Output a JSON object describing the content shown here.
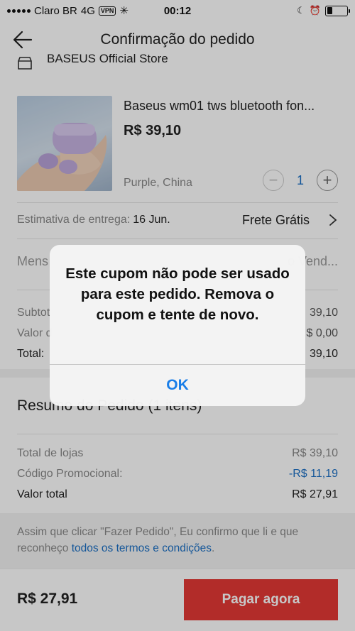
{
  "status_bar": {
    "carrier": "Claro BR",
    "network": "4G",
    "vpn": "VPN",
    "time": "00:12"
  },
  "header": {
    "title": "Confirmação do pedido"
  },
  "store": {
    "name": "BASEUS Official Store"
  },
  "product": {
    "name": "Baseus wm01 tws bluetooth fon...",
    "price": "R$ 39,10",
    "variant": "Purple, China",
    "quantity": "1",
    "minus": "−",
    "plus": "+"
  },
  "delivery": {
    "label": "Estimativa de entrega:",
    "date": "16 Jun.",
    "shipping": "Frete Grátis"
  },
  "message": {
    "left": "Mens",
    "right": "o Vend..."
  },
  "totals": {
    "rows": [
      {
        "label": "Subtot",
        "value": "39,10"
      },
      {
        "label": "Valor d",
        "value": "$ 0,00"
      },
      {
        "label": "Total:",
        "value": "39,10"
      }
    ]
  },
  "summary": {
    "title": "Resumo do Pedido (1 itens)",
    "rows": [
      {
        "label": "Total de lojas",
        "value": "R$ 39,10"
      },
      {
        "label": "Código Promocional:",
        "value": "-R$ 11,19"
      },
      {
        "label": "Valor total",
        "value": "R$ 27,91"
      }
    ]
  },
  "terms": {
    "text": "Assim que clicar \"Fazer Pedido\", Eu confirmo que li e que reconheço ",
    "link": "todos os termos e condições",
    "suffix": "."
  },
  "bottom_bar": {
    "total": "R$ 27,91",
    "pay_label": "Pagar agora"
  },
  "alert": {
    "message": "Este cupom não pode ser usado para este pedido. Remova o cupom e tente de novo.",
    "ok_label": "OK"
  },
  "colors": {
    "accent_blue": "#1a6fc4",
    "pay_red": "#e53935",
    "alert_button": "#1a7ee8"
  }
}
